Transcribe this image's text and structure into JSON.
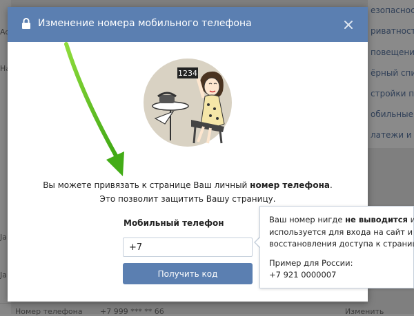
{
  "background": {
    "left_texts": [
      "Ac",
      "Ha",
      "Ja",
      "Ja"
    ],
    "menu_items": [
      "езопасност",
      "риватность",
      "повещения",
      "ёрный спис",
      "стройки пр",
      "обильные с",
      "латежи и пе"
    ],
    "bottom_texts": [
      "Номер телефона",
      "+7 999 *** ** 66",
      "Изменить"
    ]
  },
  "modal": {
    "title": "Изменение номера мобильного телефона",
    "illustration_label": "1234",
    "info_line1_pre": "Вы можете привязать к странице Ваш личный ",
    "info_line1_bold": "номер телефона",
    "info_line1_post": ".",
    "info_line2": "Это позволит защитить Вашу страницу.",
    "phone_label": "Мобильный телефон",
    "phone_value": "+7",
    "get_code_label": "Получить код"
  },
  "tooltip": {
    "line1_pre": "Ваш номер нигде ",
    "line1_bold": "не выводится",
    "line1_post": " и",
    "line2": "используется для входа на сайт и",
    "line3": "восстановления доступа к странице.",
    "line4": "Пример для России:",
    "line5": "+7 921 0000007"
  },
  "colors": {
    "header": "#5b7fb1",
    "button": "#5b7fb1",
    "arrow": "#5cbf1e"
  }
}
